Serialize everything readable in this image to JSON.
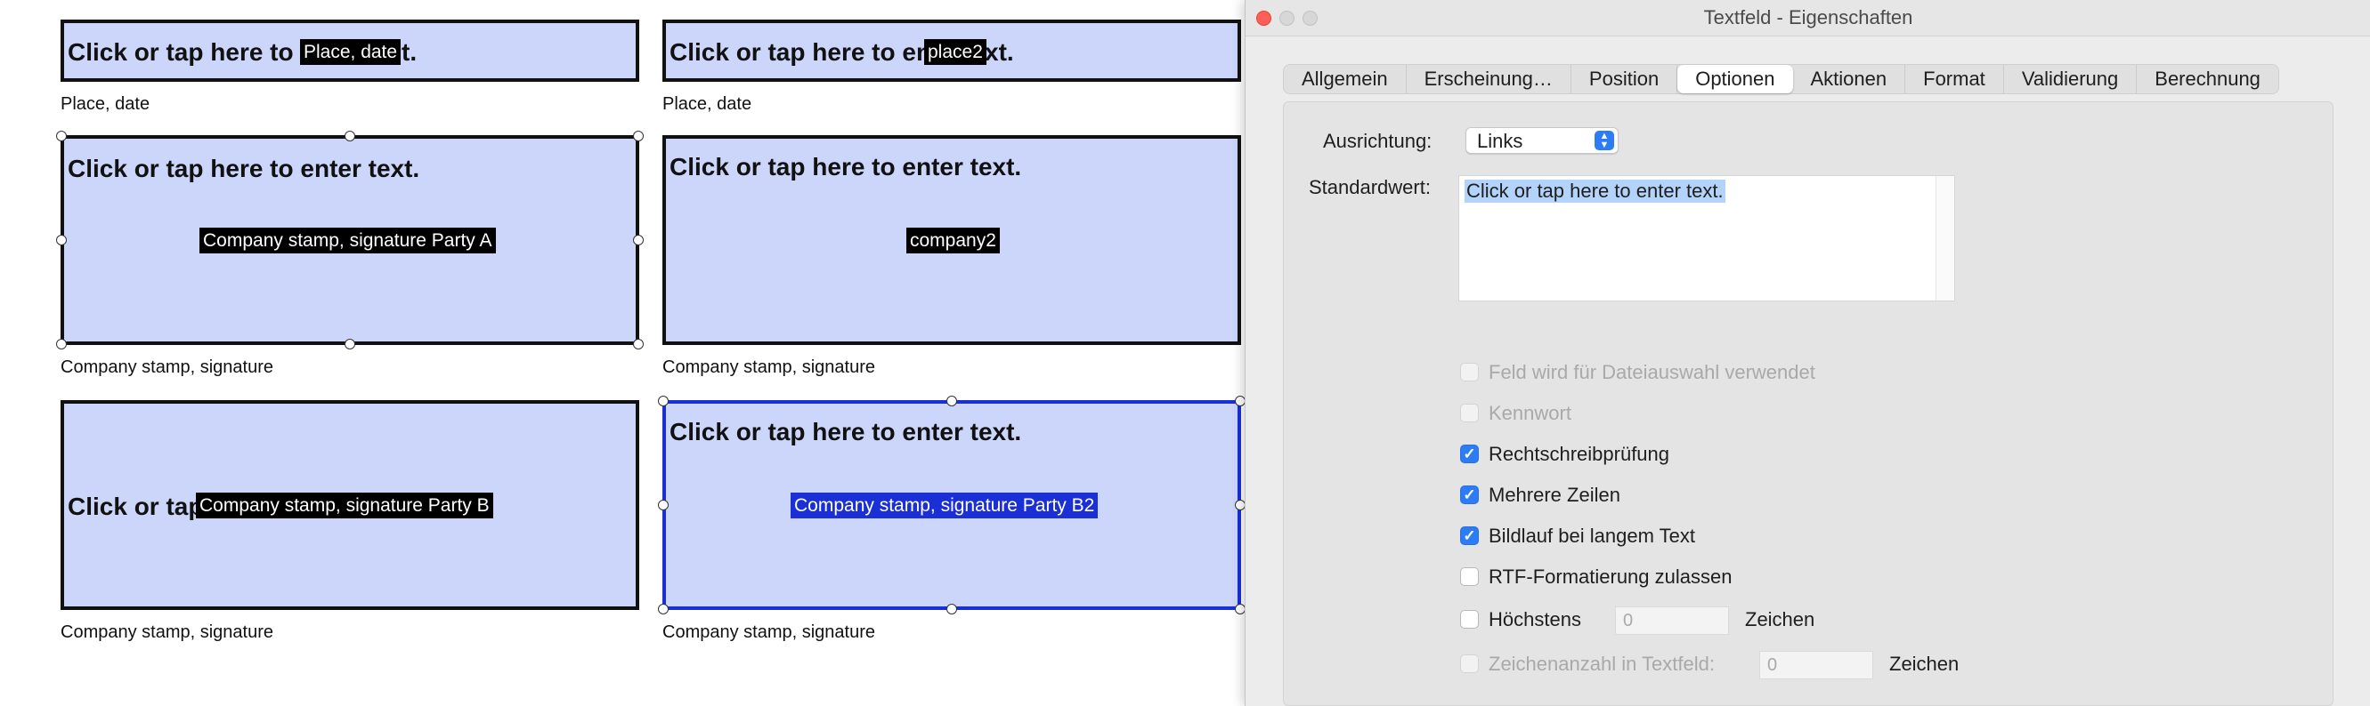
{
  "document": {
    "fields": [
      {
        "text": "Click or tap here to ",
        "tag": "Place, date",
        "after": "t.",
        "caption": "Place, date"
      },
      {
        "text": "Click or tap here to en",
        "tag": "place2",
        "after": "xt.",
        "caption": "Place, date"
      },
      {
        "text": "Click or tap here to enter text.",
        "tag": "Company stamp, signature Party A",
        "caption": "Company stamp, signature"
      },
      {
        "text": "Click or tap here to enter text.",
        "tag": "company2",
        "caption": "Company stamp, signature"
      },
      {
        "text": "Click or tap",
        "tag": "Company stamp, signature Party B",
        "caption": "Company stamp, signature"
      },
      {
        "text": "Click or tap here to enter text.",
        "tag": "Company stamp, signature Party B2",
        "caption": "Company stamp, signature"
      }
    ]
  },
  "dialog": {
    "title": "Textfeld - Eigenschaften",
    "tabs": [
      "Allgemein",
      "Erscheinung…",
      "Position",
      "Optionen",
      "Aktionen",
      "Format",
      "Validierung",
      "Berechnung"
    ],
    "active_tab": "Optionen",
    "alignment_label": "Ausrichtung:",
    "alignment_value": "Links",
    "default_label": "Standardwert:",
    "default_value": "Click or tap here to enter text.",
    "options": [
      {
        "label": "Feld wird für Dateiauswahl verwendet",
        "checked": false,
        "enabled": false
      },
      {
        "label": "Kennwort",
        "checked": false,
        "enabled": false
      },
      {
        "label": "Rechtschreibprüfung",
        "checked": true,
        "enabled": true
      },
      {
        "label": "Mehrere Zeilen",
        "checked": true,
        "enabled": true
      },
      {
        "label": "Bildlauf bei langem Text",
        "checked": true,
        "enabled": true
      },
      {
        "label": "RTF-Formatierung zulassen",
        "checked": false,
        "enabled": true
      }
    ],
    "max_chars": {
      "label": "Höchstens",
      "value": "0",
      "unit": "Zeichen"
    },
    "comb_chars": {
      "label": "Zeichenanzahl in Textfeld:",
      "value": "0",
      "unit": "Zeichen"
    },
    "colors": {
      "accent": "#2c7cf6",
      "field_fill": "#ccd6fb",
      "selection": "#1a2fd6",
      "close": "#ff5f57"
    }
  }
}
